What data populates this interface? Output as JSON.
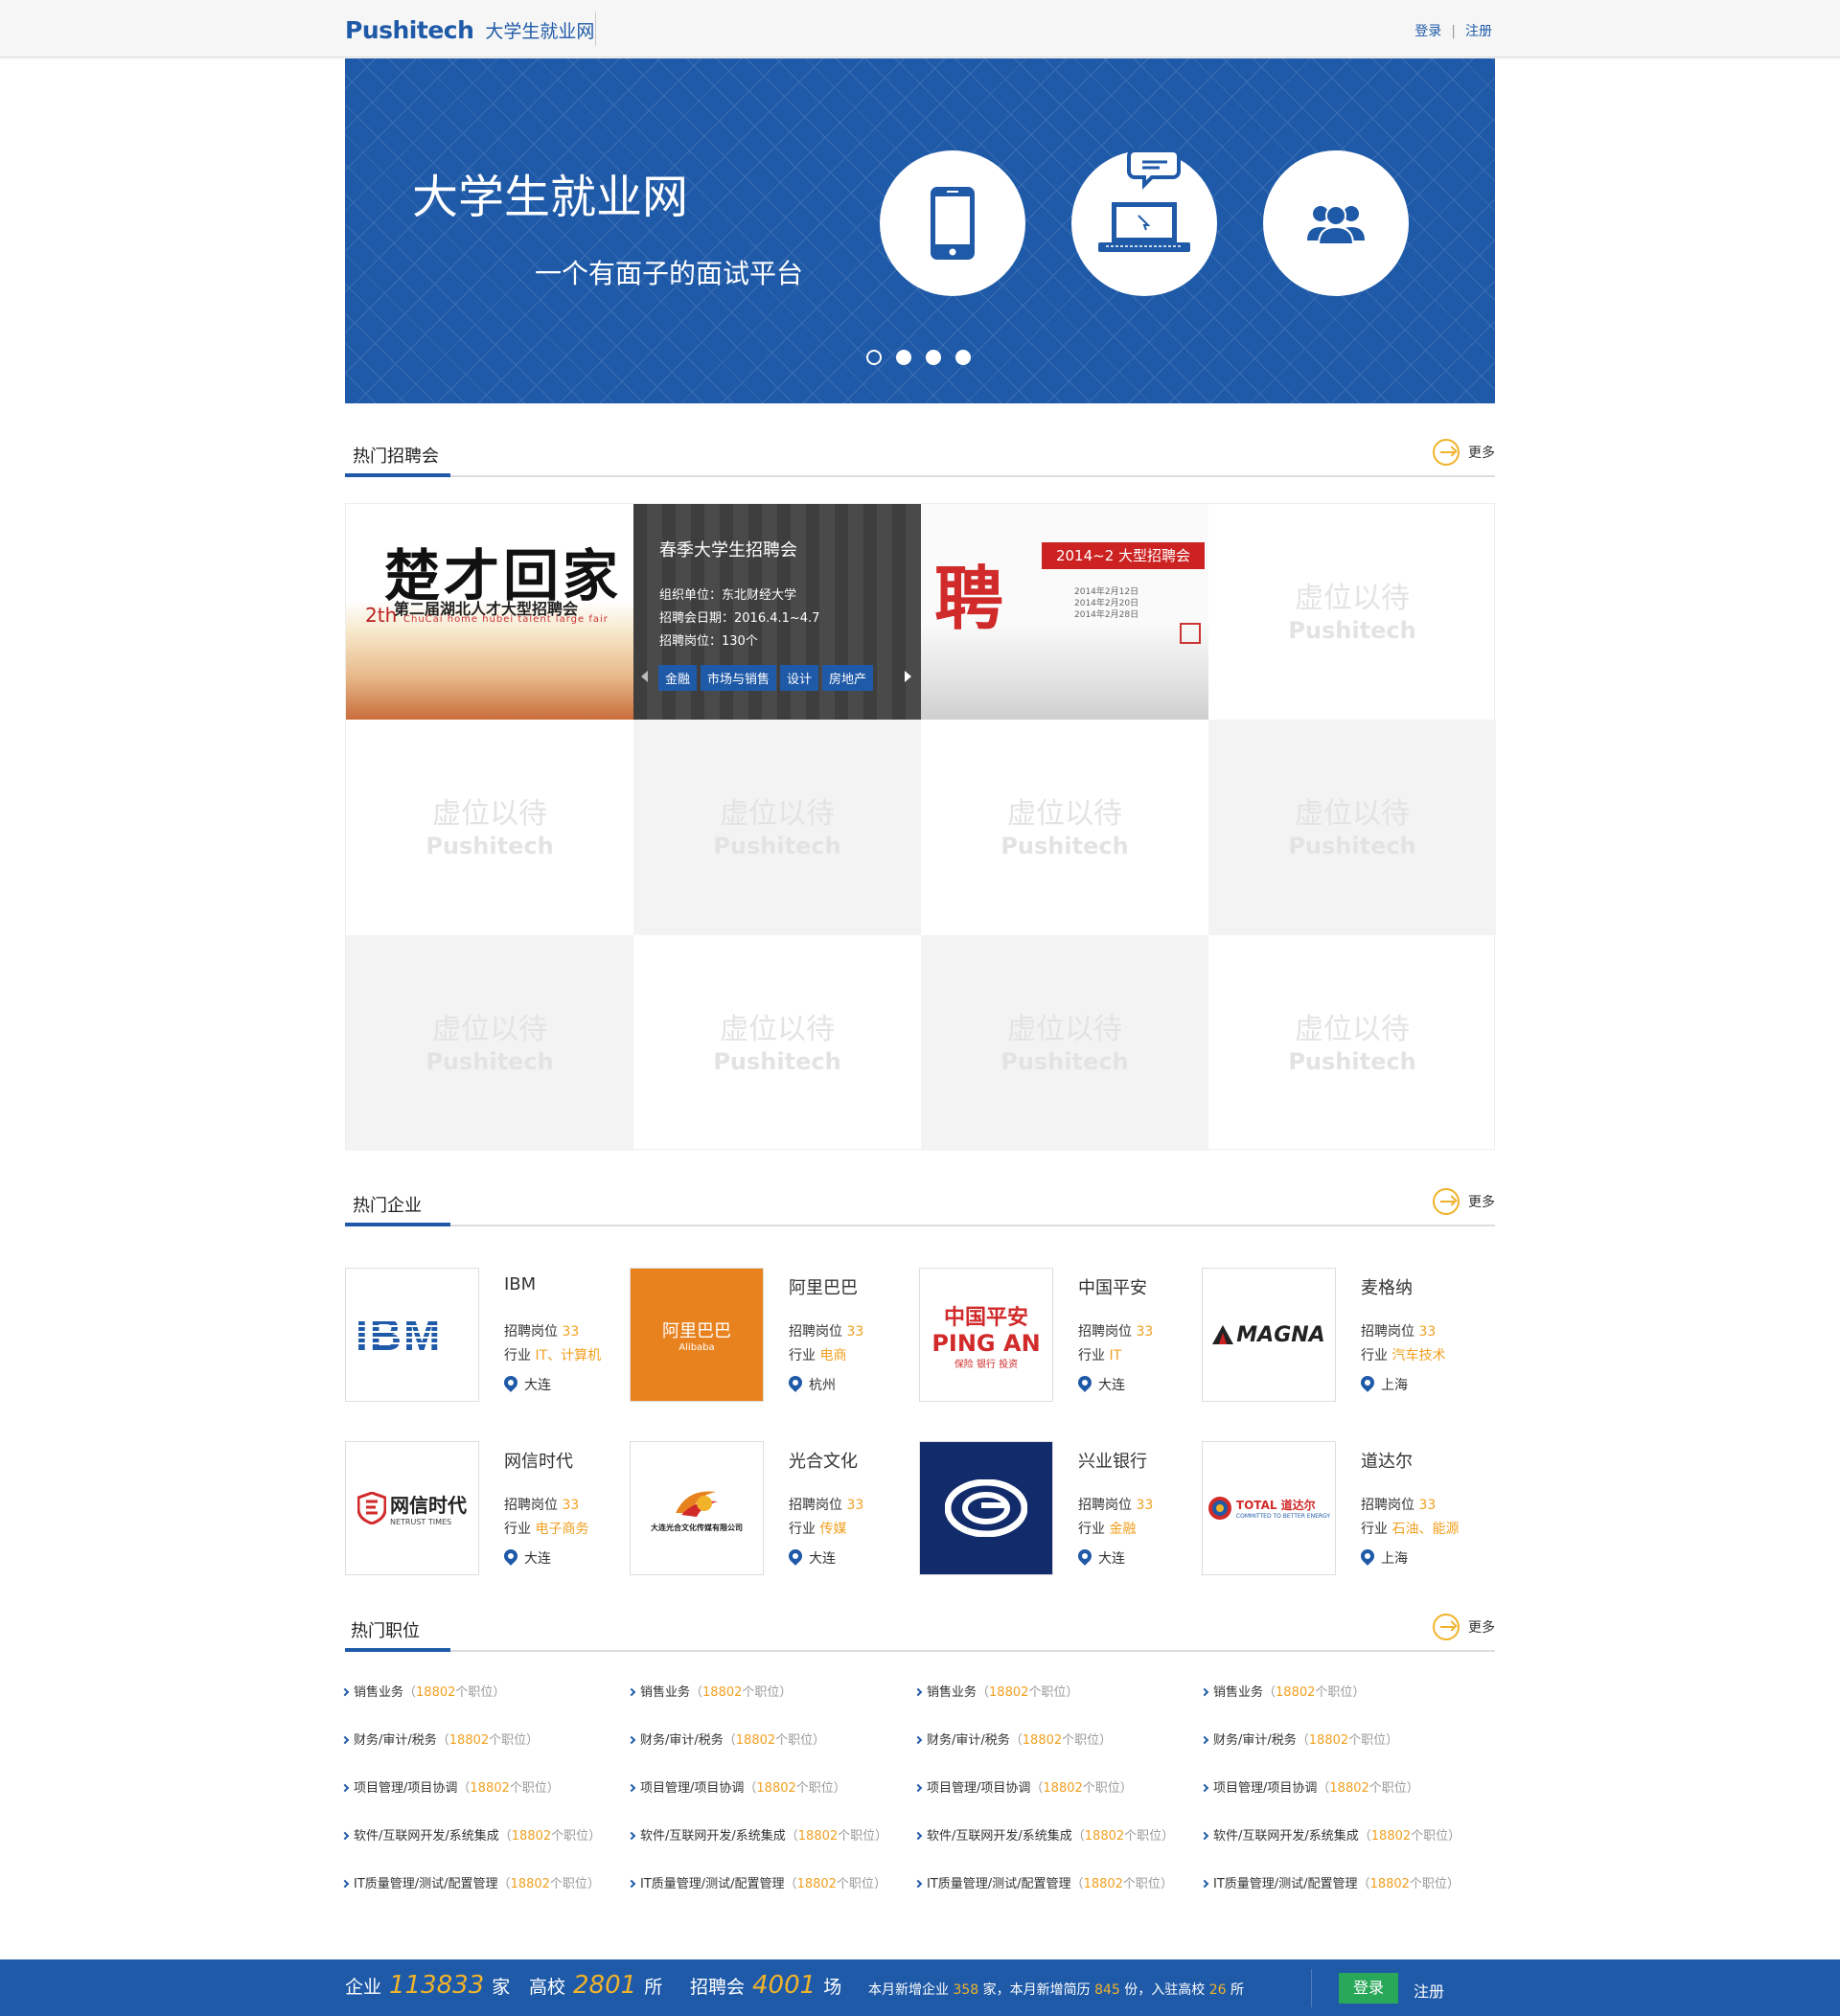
{
  "header": {
    "brand": "Pushitech",
    "site_name": "大学生就业网",
    "login": "登录",
    "separator": "|",
    "register": "注册"
  },
  "banner": {
    "title": "大学生就业网",
    "subtitle": "一个有面子的面试平台",
    "icons": [
      "phone-icon",
      "laptop-chat-icon",
      "users-icon"
    ],
    "slide_count": 4,
    "active_slide": 0
  },
  "sections": {
    "fairs": "热门招聘会",
    "companies": "热门企业",
    "jobs": "热门职位",
    "more": "更多"
  },
  "fairs": {
    "fair1": {
      "calligraphy": "楚才回家",
      "subtitle": "第二届湖北人才大型招聘会",
      "english": "ChuCai home hubei talent large fair",
      "edition": "2th"
    },
    "fair2": {
      "title": "春季大学生招聘会",
      "org": "组织单位：东北财经大学",
      "date": "招聘会日期：2016.4.1~4.7",
      "positions": "招聘岗位：130个",
      "tags": [
        "金融",
        "市场与销售",
        "设计",
        "房地产"
      ]
    },
    "fair3": {
      "char": "聘",
      "banner": "2014~2 大型招聘会",
      "dates": [
        "2014年2月12日",
        "2014年2月20日",
        "2014年2月28日"
      ]
    },
    "placeholder": {
      "line1": "虚位以待",
      "line2": "Pushitech"
    }
  },
  "companies": [
    {
      "name": "IBM",
      "positions_label": "招聘岗位",
      "positions": "33",
      "industry_label": "行业",
      "industry": "IT、计算机",
      "city": "大连",
      "logo_text": "IBM"
    },
    {
      "name": "阿里巴巴",
      "positions_label": "招聘岗位",
      "positions": "33",
      "industry_label": "行业",
      "industry": "电商",
      "city": "杭州",
      "logo_text": "阿里巴巴",
      "logo_sub": "Alibaba"
    },
    {
      "name": "中国平安",
      "positions_label": "招聘岗位",
      "positions": "33",
      "industry_label": "行业",
      "industry": "IT",
      "city": "大连",
      "logo_text": "中国平安",
      "logo_sub": "PING AN",
      "logo_sub2": "保险 银行 投资"
    },
    {
      "name": "麦格纳",
      "positions_label": "招聘岗位",
      "positions": "33",
      "industry_label": "行业",
      "industry": "汽车技术",
      "city": "上海",
      "logo_text": "MAGNA"
    },
    {
      "name": "网信时代",
      "positions_label": "招聘岗位",
      "positions": "33",
      "industry_label": "行业",
      "industry": "电子商务",
      "city": "大连",
      "logo_text": "网信时代",
      "logo_sub": "NETRUST TIMES"
    },
    {
      "name": "光合文化",
      "positions_label": "招聘岗位",
      "positions": "33",
      "industry_label": "行业",
      "industry": "传媒",
      "city": "大连",
      "logo_text": "大连光合文化传媒有限公司"
    },
    {
      "name": "兴业银行",
      "positions_label": "招聘岗位",
      "positions": "33",
      "industry_label": "行业",
      "industry": "金融",
      "city": "大连"
    },
    {
      "name": "道达尔",
      "positions_label": "招聘岗位",
      "positions": "33",
      "industry_label": "行业",
      "industry": "石油、能源",
      "city": "上海",
      "logo_text": "TOTAL 道达尔",
      "logo_sub": "COMMITTED TO BETTER ENERGY"
    }
  ],
  "jobs": {
    "rows": [
      "销售业务",
      "财务/审计/税务",
      "项目管理/项目协调",
      "软件/互联网开发/系统集成",
      "IT质量管理/测试/配置管理"
    ],
    "open": "（",
    "count": "18802",
    "unit": "个职位",
    "close": "）"
  },
  "footer": {
    "enterprise_label": "企业",
    "enterprise_num": "113833",
    "enterprise_unit": "家",
    "school_label": "高校",
    "school_num": "2801",
    "school_unit": "所",
    "fair_label": "招聘会",
    "fair_num": "4001",
    "fair_unit": "场",
    "note_a": "本月新增企业",
    "note_b": "358",
    "note_c": "家，本月新增简历",
    "note_d": "845",
    "note_e": "份，入驻高校",
    "note_f": "26",
    "note_g": "所",
    "login": "登录",
    "register": "注册"
  },
  "colors": {
    "primary": "#1f5aa8",
    "accent": "#f0b32a",
    "green": "#2aa85a"
  }
}
